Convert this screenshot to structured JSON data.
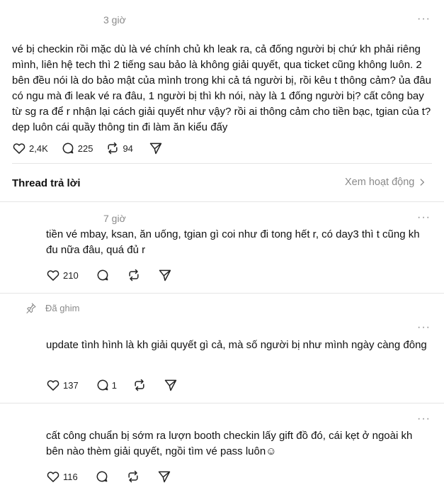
{
  "main_post": {
    "time": "3 giờ",
    "text": "vé bị checkin rồi mặc dù là vé chính chủ kh leak ra, cả đống người bị chứ kh phải riêng mình, liên hệ tech thì 2 tiếng sau bảo là không giải quyết, qua ticket cũng không luôn. 2 bên đều nói là do bảo mật của mình trong khi cả tá người bị, rồi kêu t thông cảm? ủa đâu có ngu mà đi leak vé ra đâu, 1 người bị thì kh nói, này là 1 đống người bị? cất công bay từ sg ra để r nhận lại cách giải quyết như vậy? rồi ai thông cảm cho tiền bạc, tgian của t? dẹp luôn cái quầy thông tin đi làm ăn kiểu đấy",
    "likes": "2,4K",
    "comments": "225",
    "reposts": "94"
  },
  "thread_header": {
    "title": "Thread trả lời",
    "activity_link": "Xem hoạt động"
  },
  "replies": [
    {
      "time": "7 giờ",
      "text": "tiền vé mbay, ksan, ăn uống, tgian gì coi như đi tong hết r, có day3 thì t cũng kh đu nữa đâu, quá đủ r",
      "likes": "210"
    },
    {
      "pinned_label": "Đã ghim",
      "text": "update tình hình là kh giải quyết gì cả, mà số người bị như mình ngày càng đông",
      "likes": "137",
      "comments": "1"
    },
    {
      "text": "cất công chuẩn bị sớm ra lượn booth checkin lấy gift đồ đó, cái kẹt ở ngoài kh bên nào thèm giải quyết, ngồi tìm vé pass luôn☺",
      "likes": "116"
    }
  ],
  "more_glyph": "···"
}
